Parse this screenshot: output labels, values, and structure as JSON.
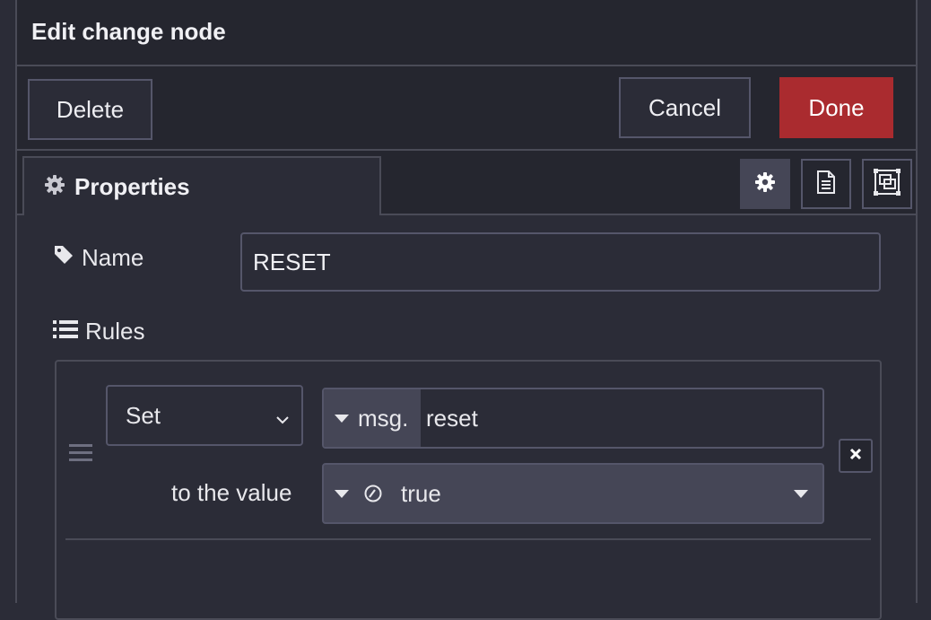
{
  "tray": {
    "title": "Edit change node"
  },
  "toolbar": {
    "delete_label": "Delete",
    "cancel_label": "Cancel",
    "done_label": "Done"
  },
  "tabs": {
    "properties_label": "Properties",
    "icons": [
      "gear-icon",
      "description-icon",
      "appearance-icon"
    ]
  },
  "form": {
    "name_label": "Name",
    "name_value": "RESET",
    "rules_label": "Rules"
  },
  "rule": {
    "action": "Set",
    "property_type": "msg.",
    "property_value": "reset",
    "to_label": "to the value",
    "value": "true",
    "value_type_icon": "boolean-icon"
  },
  "colors": {
    "background": "#2b2c37",
    "header": "#25262f",
    "border": "#4a4b57",
    "done": "#aa2b2f",
    "accent_field": "#454656"
  }
}
